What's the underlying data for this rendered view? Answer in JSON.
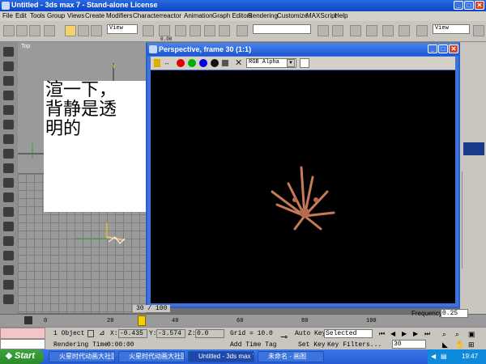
{
  "window": {
    "title": "Untitled - 3ds max 7 - Stand-alone License"
  },
  "menu": [
    "File",
    "Edit",
    "Tools",
    "Group",
    "Views",
    "Create",
    "Modifiers",
    "Character",
    "reactor",
    "Animation",
    "Graph Editors",
    "Rendering",
    "Customize",
    "MAXScript",
    "Help"
  ],
  "toolbar": {
    "view_dropdown": "View",
    "view_dropdown2": "View",
    "counter": "0.00"
  },
  "viewports": {
    "top_label": "Top"
  },
  "overlay_text": {
    "lines": [
      "渲一下，",
      "背静是透",
      "明的"
    ]
  },
  "render_window": {
    "title": "Perspective, frame 30 (1:1)",
    "channel": "RGB Alpha"
  },
  "timeline": {
    "frame_display": "30 / 100",
    "ticks": [
      "0",
      "20",
      "40",
      "60",
      "80",
      "100"
    ]
  },
  "status": {
    "selection": "1 Object",
    "x_label": "X:",
    "x_value": "-0.435",
    "y_label": "Y:",
    "y_value": "-3.574",
    "z_label": "Z:",
    "z_value": "0.0",
    "grid": "Grid = 10.0",
    "rendering_time_label": "Rendering Time",
    "rendering_time": "0:00:00",
    "add_time_tag": "Add Time Tag",
    "auto_key": "Auto Key",
    "auto_key_value": "Selected",
    "set_key": "Set Key",
    "key_filters": "Key Filters...",
    "frame_value": "30",
    "frequency_label": "Frequency:",
    "frequency_value": "0.25"
  },
  "taskbar": {
    "start": "Start",
    "tasks": [
      "火星时代动画大社区...",
      "火星时代动画大社区...",
      "Untitled - 3ds max 7 ...",
      "未命名 - 画图"
    ],
    "clock": "19:47"
  }
}
